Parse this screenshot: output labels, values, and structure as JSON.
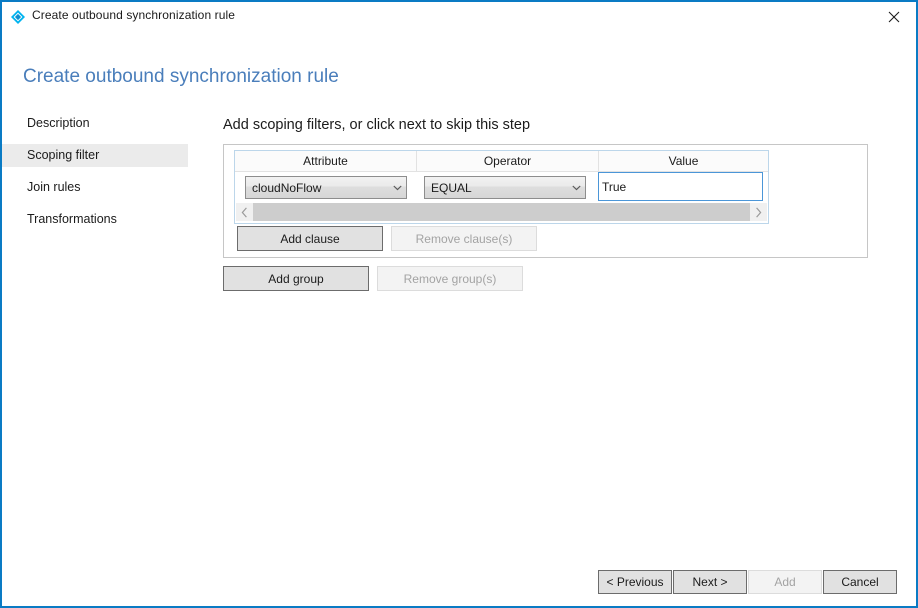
{
  "window": {
    "title": "Create outbound synchronization rule",
    "app_icon": "sync-rule-diamond-icon",
    "close_label": "✕",
    "border_color": "#0a7bc4"
  },
  "page": {
    "heading": "Create outbound synchronization rule",
    "heading_color": "#4a7ebb"
  },
  "sidebar": {
    "items": [
      {
        "label": "Description",
        "selected": false
      },
      {
        "label": "Scoping filter",
        "selected": true
      },
      {
        "label": "Join rules",
        "selected": false
      },
      {
        "label": "Transformations",
        "selected": false
      }
    ]
  },
  "main": {
    "instruction": "Add scoping filters, or click next to skip this step",
    "grid": {
      "columns": [
        "Attribute",
        "Operator",
        "Value"
      ],
      "rows": [
        {
          "attribute": "cloudNoFlow",
          "operator": "EQUAL",
          "value": "True"
        }
      ]
    },
    "scrollbar": {
      "left_arrow": "chevron-left",
      "right_arrow": "chevron-right"
    },
    "clause_buttons": {
      "add": "Add clause",
      "remove": "Remove clause(s)",
      "remove_enabled": false
    },
    "group_buttons": {
      "add": "Add group",
      "remove": "Remove group(s)",
      "remove_enabled": false
    }
  },
  "footer": {
    "previous": "< Previous",
    "next": "Next >",
    "add": "Add",
    "add_enabled": false,
    "cancel": "Cancel"
  }
}
